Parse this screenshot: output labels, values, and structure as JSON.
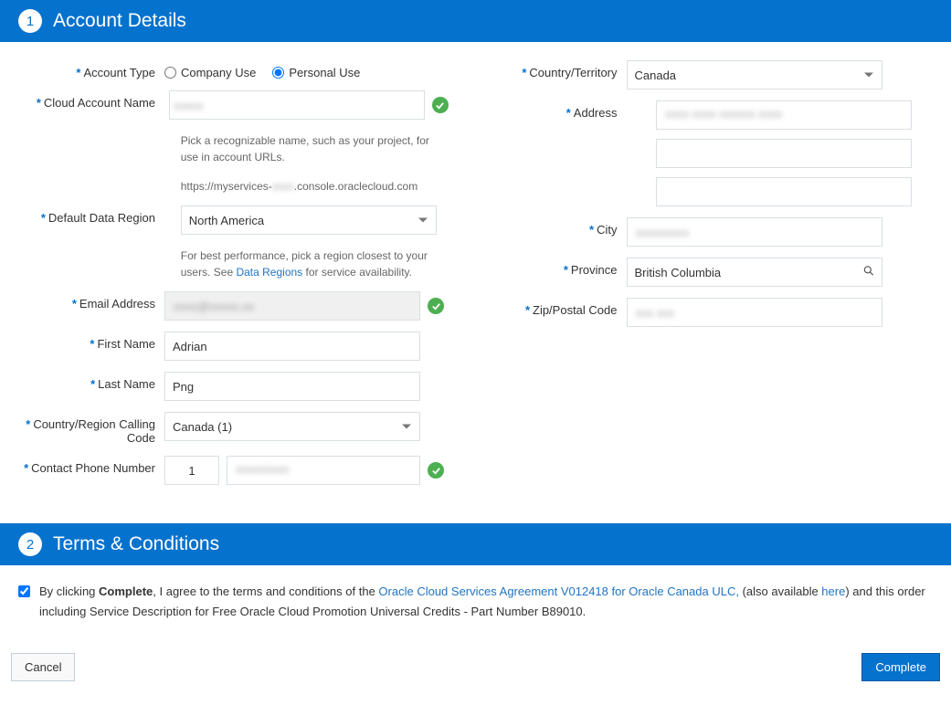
{
  "section1": {
    "num": "1",
    "title": "Account Details"
  },
  "section2": {
    "num": "2",
    "title": "Terms & Conditions"
  },
  "labels": {
    "account_type": "Account Type",
    "cloud_account_name": "Cloud Account Name",
    "default_region": "Default Data Region",
    "email": "Email Address",
    "first_name": "First Name",
    "last_name": "Last Name",
    "calling_code": "Country/Region Calling Code",
    "phone": "Contact Phone Number",
    "country": "Country/Territory",
    "address": "Address",
    "city": "City",
    "province": "Province",
    "zip": "Zip/Postal Code"
  },
  "radios": {
    "company": "Company Use",
    "personal": "Personal Use"
  },
  "values": {
    "cloud_account_name": "xxxxx",
    "region": "North America",
    "email": "xxxx@xxxxx.xx",
    "first_name": "Adrian",
    "last_name": "Png",
    "calling_code": "Canada (1)",
    "phone_cc": "1",
    "phone_num": "xxxxxxxxx",
    "country": "Canada",
    "address1": "xxxx xxxx xxxxxx xxxx",
    "city": "xxxxxxxxx",
    "province": "British Columbia",
    "zip": "xxx xxx"
  },
  "helpers": {
    "cloud_name_help": "Pick a recognizable name, such as your project, for use in account URLs.",
    "cloud_name_url_prefix": "https://myservices-",
    "cloud_name_url_mid": "xxxx",
    "cloud_name_url_suffix": ".console.oraclecloud.com",
    "region_help_pre": "For best performance, pick a region closest to your users. See ",
    "region_help_link": "Data Regions",
    "region_help_post": " for service availability."
  },
  "terms": {
    "pre": "By clicking ",
    "bold": "Complete",
    "mid1": ", I agree to the terms and conditions of the ",
    "link1": "Oracle Cloud Services Agreement V012418 for Oracle Canada ULC,",
    "mid2": " (also available ",
    "link2": "here",
    "post": ") and this order including Service Description for Free Oracle Cloud Promotion Universal Credits - Part Number B89010."
  },
  "buttons": {
    "cancel": "Cancel",
    "complete": "Complete"
  }
}
